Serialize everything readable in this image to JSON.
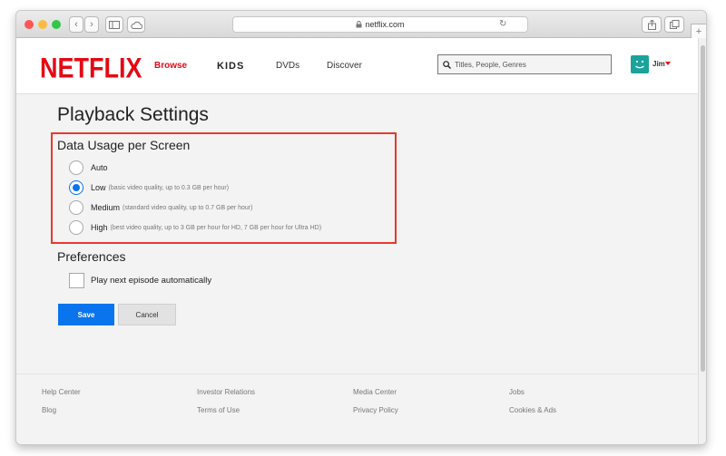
{
  "browser": {
    "url": "netflix.com",
    "traffic_lights": [
      "#fc5753",
      "#fdbc40",
      "#33c748"
    ]
  },
  "nav": {
    "logo": "NETFLIX",
    "links": [
      "Browse",
      "KIDS",
      "DVDs",
      "Discover"
    ],
    "active_link": "Browse",
    "search_placeholder": "Titles, People, Genres",
    "profile_name": "Jim"
  },
  "settings": {
    "title": "Playback Settings",
    "data_usage_title": "Data Usage per Screen",
    "options": [
      {
        "label": "Auto",
        "desc": "",
        "selected": false
      },
      {
        "label": "Low",
        "desc": "(basic video quality, up to 0.3 GB per hour)",
        "selected": true
      },
      {
        "label": "Medium",
        "desc": "(standard video quality, up to 0.7 GB per hour)",
        "selected": false
      },
      {
        "label": "High",
        "desc": "(best video quality, up to 3 GB per hour for HD, 7 GB per hour for Ultra HD)",
        "selected": false
      }
    ],
    "preferences_title": "Preferences",
    "autoplay_label": "Play next episode automatically",
    "autoplay_checked": false,
    "save_label": "Save",
    "cancel_label": "Cancel"
  },
  "footer": {
    "links": [
      "Help Center",
      "Investor Relations",
      "Media Center",
      "Jobs",
      "Blog",
      "Terms of Use",
      "Privacy Policy",
      "Cookies & Ads"
    ]
  },
  "colors": {
    "brand_red": "#e50914",
    "accent_blue": "#0a74ee",
    "highlight_red": "#e8382e"
  }
}
